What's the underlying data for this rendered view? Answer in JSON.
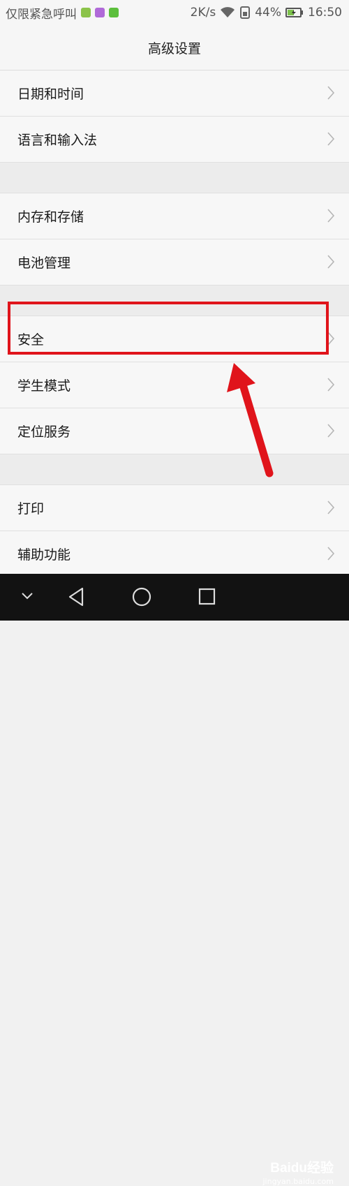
{
  "status_bar": {
    "carrier": "仅限紧急呼叫",
    "speed": "2K/s",
    "battery": "44%",
    "time": "16:50",
    "app_icon_colors": [
      "#8bc34a",
      "#b06ad8",
      "#5cbf3c"
    ]
  },
  "header": {
    "title": "高级设置"
  },
  "groups": [
    {
      "items": [
        {
          "label": "日期和时间"
        },
        {
          "label": "语言和输入法"
        }
      ]
    },
    {
      "items": [
        {
          "label": "内存和存储"
        },
        {
          "label": "电池管理"
        }
      ]
    },
    {
      "items": [
        {
          "label": "安全"
        },
        {
          "label": "学生模式"
        },
        {
          "label": "定位服务"
        }
      ]
    },
    {
      "items": [
        {
          "label": "打印"
        },
        {
          "label": "辅助功能"
        }
      ]
    }
  ],
  "annotation": {
    "color": "#e0141b"
  },
  "watermark": {
    "brand": "Baidu经验",
    "url": "jingyan.baidu.com"
  }
}
